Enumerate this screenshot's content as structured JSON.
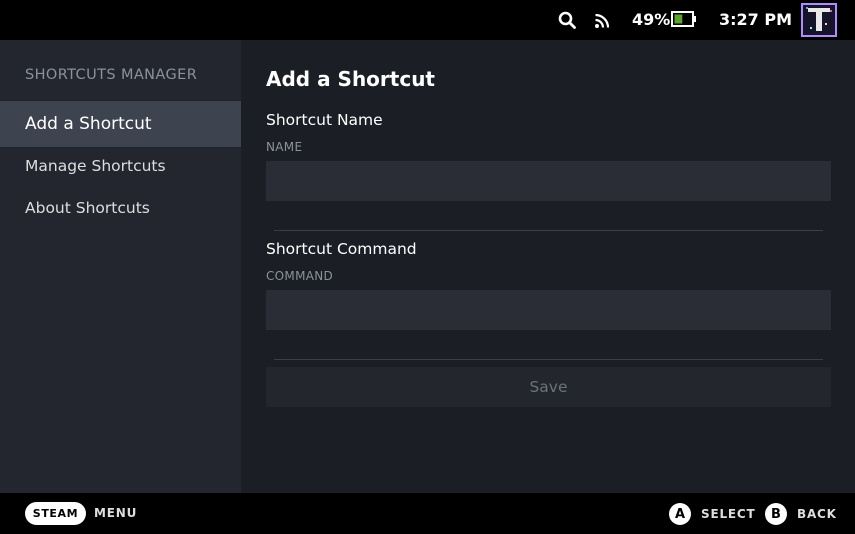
{
  "status_bar": {
    "battery_percent": "49%",
    "battery_level": 0.49,
    "time": "3:27 PM",
    "icons": [
      "search-icon",
      "wifi-icon",
      "battery-icon"
    ],
    "battery_color": "#5ba32b"
  },
  "sidebar": {
    "heading": "SHORTCUTS MANAGER",
    "items": [
      {
        "label": "Add a Shortcut",
        "active": true
      },
      {
        "label": "Manage Shortcuts",
        "active": false
      },
      {
        "label": "About Shortcuts",
        "active": false
      }
    ]
  },
  "main": {
    "title": "Add a Shortcut",
    "fields": [
      {
        "label": "Shortcut Name",
        "sublabel": "NAME",
        "value": ""
      },
      {
        "label": "Shortcut Command",
        "sublabel": "COMMAND",
        "value": ""
      }
    ],
    "save_label": "Save"
  },
  "bottom_bar": {
    "steam_label": "STEAM",
    "menu_label": "MENU",
    "a_button": "A",
    "a_label": "SELECT",
    "b_button": "B",
    "b_label": "BACK"
  }
}
